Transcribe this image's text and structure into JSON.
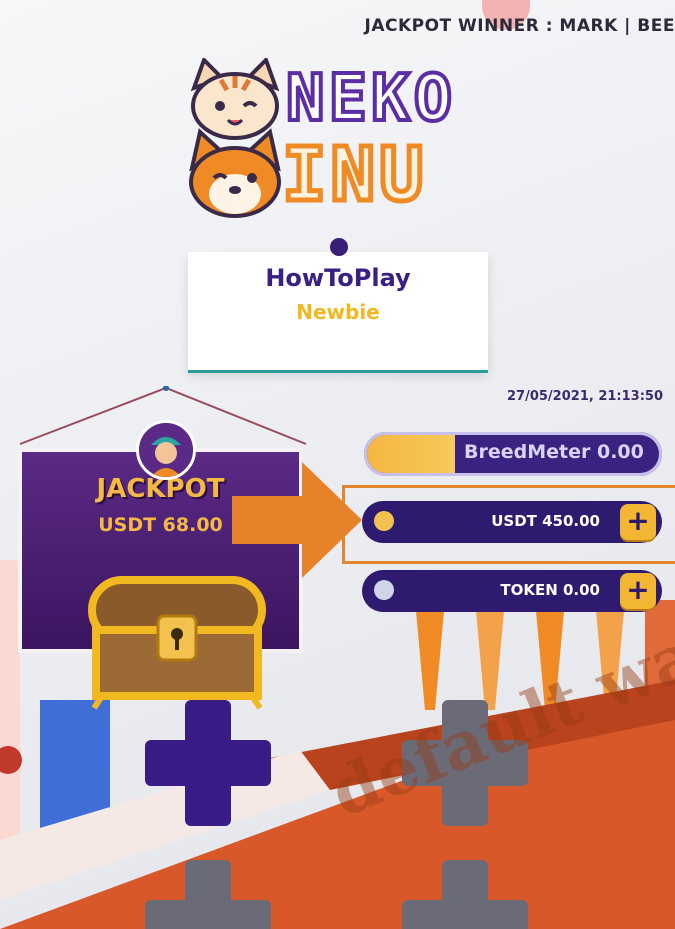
{
  "ticker": {
    "text": "JACKPOT WINNER : MARK | BEE"
  },
  "logo": {
    "line1": "NEKO",
    "line2": "INU"
  },
  "how_to_play": {
    "title": "HowToPlay",
    "subtitle": "Newbie"
  },
  "datetime": "27/05/2021, 21:13:50",
  "jackpot": {
    "title": "JACKPOT",
    "amount": "USDT 68.00"
  },
  "breed_meter": {
    "label": "BreedMeter 0.00",
    "fill_fraction": 0.3
  },
  "balances": {
    "usdt": {
      "amount": "USDT 450.00",
      "plus_label": "+"
    },
    "token": {
      "amount": "TOKEN 0.00",
      "plus_label": "+"
    }
  },
  "watermark": "default wat",
  "colors": {
    "purple": "#2e1a6e",
    "gold": "#f3b633",
    "orange": "#e3852c"
  }
}
